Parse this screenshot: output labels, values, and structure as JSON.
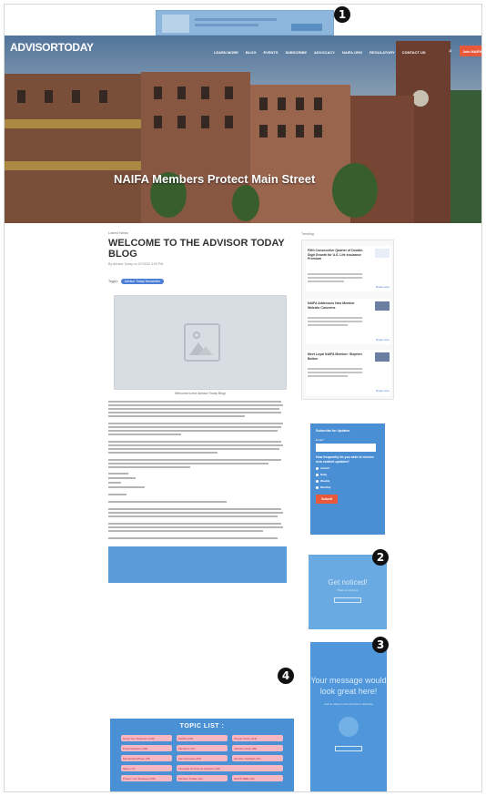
{
  "brand": {
    "logo_part1": "ADVISOR",
    "logo_part2": "TODAY"
  },
  "nav": {
    "items": [
      "Learn More",
      "Blog",
      "Events",
      "Subscribe",
      "Advocacy",
      "NAIFA.org",
      "Regulatory",
      "Contact Us"
    ],
    "search_icon": "search-icon",
    "join_label": "Join NAIFA"
  },
  "hero": {
    "title": "NAIFA Members Protect Main Street"
  },
  "article": {
    "category": "Latest News",
    "title": "WELCOME TO THE ADVISOR TODAY BLOG",
    "byline": "By Advisor Today on 2/7/2022 3:00 PM",
    "tags_label": "Tag(s):",
    "tag": "Advisor Today Newsletter",
    "image_caption": "Welcome to the Advisor Today Blog!"
  },
  "sidebar": {
    "section_label": "Trending",
    "posts": [
      {
        "title": "Fifth Consecutive Quarter of Double-Digit Growth for U.S. Life Insurance Premium",
        "more": "Read more"
      },
      {
        "title": "NAIFA Addresses New Member Website Concerns",
        "more": "Read more"
      },
      {
        "title": "Meet Loyal NAIFA Member: Stephen Bolton",
        "more": "Read more"
      }
    ],
    "subscribe": {
      "title": "Subscribe for Updates",
      "email_label": "Email *",
      "question": "How frequently do you wish to receive new content updates?",
      "options": [
        "Instant",
        "Daily",
        "Weekly",
        "Monthly"
      ],
      "button": "Submit"
    },
    "ad_small": {
      "title": "Get noticed!",
      "sub": "Place an ad here",
      "button": "Learn more"
    },
    "ad_large": {
      "title": "Your message would look great here!",
      "sub": "Call us today to find out how to advertise",
      "button": "Learn more"
    }
  },
  "topics": {
    "title": "TOPIC LIST :",
    "items": [
      "Grow Your Business (118)",
      "NAIFA (175)",
      "People News (113)",
      "Press Release (104)",
      "Members (67)",
      "Industry News (89)",
      "Membership/Pays (36)",
      "Life Insurance (55)",
      "Member Spotlight (31)",
      "Sales (71)",
      "Financial Fortune for Advisors (30)",
      "",
      "Protect Your Business (58)",
      "Member Profile (40)",
      "NAIFF ($$$) (30)"
    ]
  },
  "markers": {
    "m1": "1",
    "m2": "2",
    "m3": "3",
    "m4": "4"
  },
  "colors": {
    "accent": "#4a8fd3",
    "join": "#e8583a",
    "ad": "#6aaae2"
  }
}
